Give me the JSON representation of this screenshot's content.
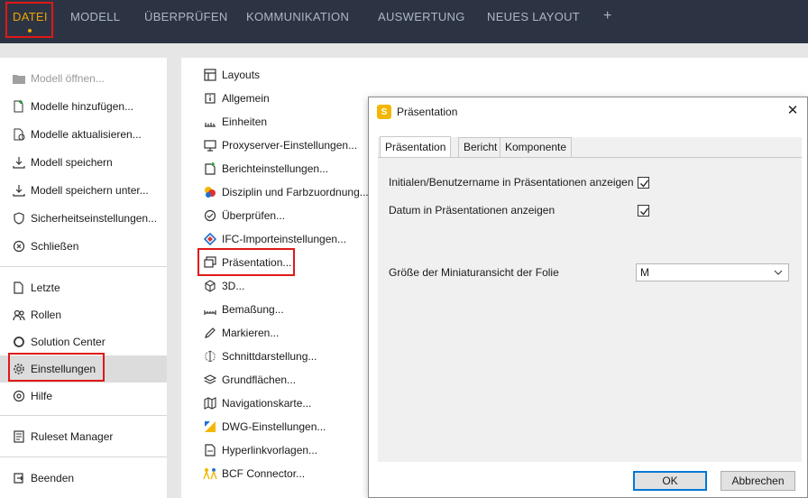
{
  "menu": {
    "tabs": [
      {
        "label": "DATEI",
        "active": true
      },
      {
        "label": "MODELL"
      },
      {
        "label": "ÜBERPRÜFEN"
      },
      {
        "label": "KOMMUNIKATION"
      },
      {
        "label": "AUSWERTUNG"
      },
      {
        "label": "NEUES LAYOUT"
      }
    ],
    "plus": "+"
  },
  "leftnav": {
    "items": [
      {
        "label": "Modell öffnen...",
        "icon": "folder-icon",
        "disabled": true
      },
      {
        "label": "Modelle hinzufügen...",
        "icon": "add-file-icon"
      },
      {
        "label": "Modelle aktualisieren...",
        "icon": "refresh-file-icon"
      },
      {
        "label": "Modell speichern",
        "icon": "download-icon"
      },
      {
        "label": "Modell speichern unter...",
        "icon": "download-as-icon"
      },
      {
        "label": "Sicherheitseinstellungen...",
        "icon": "shield-icon"
      },
      {
        "label": "Schließen",
        "icon": "close-circle-icon"
      },
      {
        "label": "Letzte",
        "icon": "recent-file-icon"
      },
      {
        "label": "Rollen",
        "icon": "roles-icon"
      },
      {
        "label": "Solution Center",
        "icon": "circle-icon"
      },
      {
        "label": "Einstellungen",
        "icon": "gear-icon",
        "selected": true
      },
      {
        "label": "Hilfe",
        "icon": "help-icon"
      },
      {
        "label": "Ruleset Manager",
        "icon": "ruleset-icon"
      },
      {
        "label": "Beenden",
        "icon": "exit-icon"
      }
    ]
  },
  "settings": {
    "items": [
      {
        "label": "Layouts",
        "icon": "layout-icon"
      },
      {
        "label": "Allgemein",
        "icon": "info-icon"
      },
      {
        "label": "Einheiten",
        "icon": "ruler-icon"
      },
      {
        "label": "Proxyserver-Einstellungen...",
        "icon": "proxy-icon"
      },
      {
        "label": "Berichteinstellungen...",
        "icon": "report-icon"
      },
      {
        "label": "Disziplin und Farbzuordnung...",
        "icon": "color-icon"
      },
      {
        "label": "Überprüfen...",
        "icon": "check-shield-icon"
      },
      {
        "label": "IFC-Importeinstellungen...",
        "icon": "ifc-icon"
      },
      {
        "label": "Präsentation...",
        "icon": "presentation-icon"
      },
      {
        "label": "3D...",
        "icon": "cube-icon"
      },
      {
        "label": "Bemaßung...",
        "icon": "dimension-icon"
      },
      {
        "label": "Markieren...",
        "icon": "pen-icon"
      },
      {
        "label": "Schnittdarstellung...",
        "icon": "section-icon"
      },
      {
        "label": "Grundflächen...",
        "icon": "layers-icon"
      },
      {
        "label": "Navigationskarte...",
        "icon": "map-icon"
      },
      {
        "label": "DWG-Einstellungen...",
        "icon": "dwg-icon"
      },
      {
        "label": "Hyperlinkvorlagen...",
        "icon": "hyperlink-icon"
      },
      {
        "label": "BCF Connector...",
        "icon": "bcf-icon"
      }
    ]
  },
  "dialog": {
    "logo": "S",
    "title": "Präsentation",
    "close": "✕",
    "tabs": [
      "Präsentation",
      "Bericht",
      "Komponente"
    ],
    "options": [
      {
        "label": "Initialen/Benutzername in Präsentationen anzeigen",
        "checked": true
      },
      {
        "label": "Datum in Präsentationen anzeigen",
        "checked": true
      }
    ],
    "thumb_size": {
      "label": "Größe der Miniaturansicht der Folie",
      "value": "M"
    },
    "ok": "OK",
    "cancel": "Abbrechen"
  },
  "colors": {
    "topbar": "#2c3444",
    "accent": "#f0a500",
    "highlight": "#e01818"
  }
}
